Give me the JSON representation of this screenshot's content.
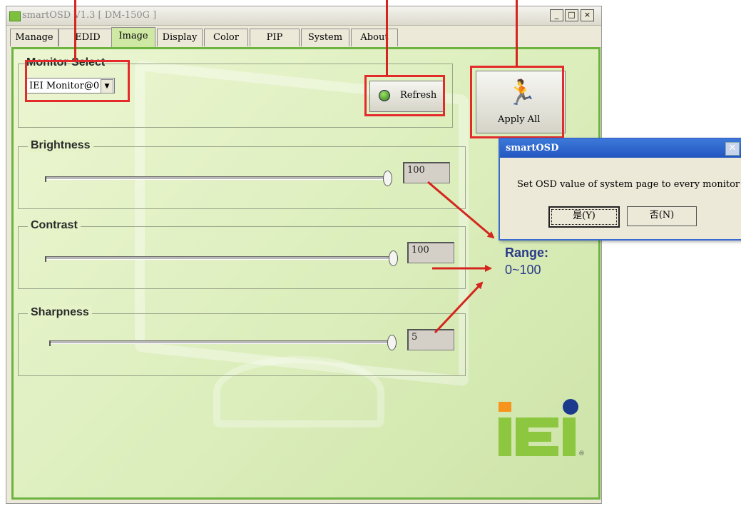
{
  "window": {
    "title": "smartOSD V1.3 [ DM-150G ]",
    "minimize": "_",
    "maximize": "□",
    "close": "×"
  },
  "tabs": [
    {
      "label": "Manage"
    },
    {
      "label": "EDID"
    },
    {
      "label": "Image",
      "active": true
    },
    {
      "label": "Display"
    },
    {
      "label": "Color"
    },
    {
      "label": "PIP"
    },
    {
      "label": "System"
    },
    {
      "label": "About"
    }
  ],
  "monitor_select": {
    "label": "Monitor Select",
    "value": "IEI Monitor@0"
  },
  "refresh_label": "Refresh",
  "apply_all_label": "Apply All",
  "sliders": [
    {
      "label": "Brightness",
      "value": "100",
      "level": 1.0
    },
    {
      "label": "Contrast",
      "value": "100",
      "level": 1.0
    },
    {
      "label": "Sharpness",
      "value": "5",
      "level": 1.0
    }
  ],
  "range_annotation": {
    "title": "Range:",
    "value": "0~100"
  },
  "dialog": {
    "title": "smartOSD",
    "message": "Set OSD value of system page to every monitor",
    "yes_label": "是(Y)",
    "no_label": "否(N)"
  },
  "logo": {
    "text": "iEi"
  },
  "colors": {
    "accent_red": "#e32b2b",
    "panel_green": "#6db33f",
    "range_text": "#2a3a8a",
    "logo_green": "#8dc63f",
    "logo_orange": "#f7941d",
    "logo_blue": "#1b3a8c"
  }
}
